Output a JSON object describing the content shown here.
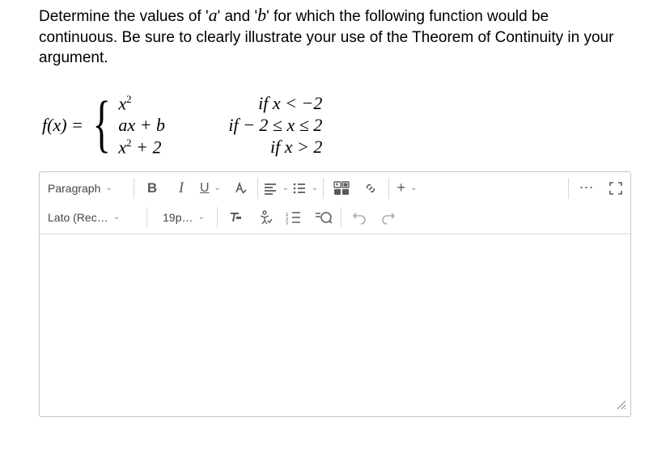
{
  "question": {
    "pre": "Determine the values of '",
    "a": "a",
    "mid1": "' and '",
    "b": "b",
    "post": "' for which the following function would be continuous. Be sure to clearly illustrate your use of the Theorem of Continuity in your argument."
  },
  "math": {
    "lhs": "f(x) = ",
    "rows": [
      {
        "expr": "x²",
        "cond": "if x < −2"
      },
      {
        "expr": "ax + b",
        "cond": "if − 2 ≤ x ≤ 2"
      },
      {
        "expr": "x² + 2",
        "cond": "if x > 2"
      }
    ]
  },
  "toolbar": {
    "row1": {
      "block_style": "Paragraph",
      "bold": "B",
      "italic": "I",
      "underline": "U"
    },
    "row2": {
      "font_family": "Lato (Rec…",
      "font_size": "19p…"
    },
    "more": "⋯"
  },
  "icons": {
    "font_color": "font-color",
    "align": "align",
    "list": "list",
    "media": "media",
    "link": "link",
    "plus": "+",
    "expand": "expand",
    "clear_format": "clear-format",
    "check": "check",
    "line_spacing": "line-spacing",
    "equation": "equation",
    "undo": "undo",
    "redo": "redo",
    "resize": "resize"
  }
}
